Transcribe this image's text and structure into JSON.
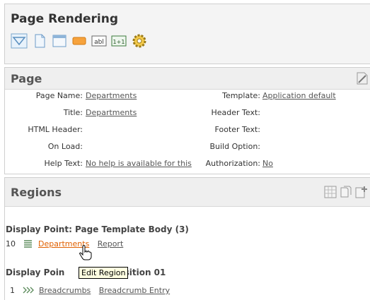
{
  "rendering": {
    "title": "Page Rendering",
    "toolbar_icons": [
      "triangle-filter-icon",
      "page-icon",
      "region-icon",
      "button-icon",
      "text-item-icon",
      "computation-icon",
      "process-icon"
    ],
    "text_item_glyph": "abl",
    "computation_glyph": "1+1"
  },
  "page": {
    "title": "Page",
    "fields": {
      "page_name_label": "Page Name:",
      "page_name_value": "Departments",
      "title_label": "Title:",
      "title_value": "Departments",
      "html_header_label": "HTML Header:",
      "on_load_label": "On Load:",
      "help_text_label": "Help Text:",
      "help_text_value": "No help is available for this",
      "template_label": "Template:",
      "template_value": "Application default",
      "header_text_label": "Header Text:",
      "footer_text_label": "Footer Text:",
      "build_option_label": "Build Option:",
      "authorization_label": "Authorization:",
      "authorization_value": "No"
    }
  },
  "regions": {
    "title": "Regions",
    "group1": {
      "heading": "Display Point: Page Template Body (3)",
      "row": {
        "seq": "10",
        "name": "Departments",
        "type": "Report"
      }
    },
    "group2": {
      "heading_part1": "Display Poin",
      "heading_part2": "osition 01",
      "row": {
        "seq": "1",
        "name": "Breadcrumbs",
        "type": "Breadcrumb Entry"
      }
    },
    "tooltip": "Edit Region"
  },
  "colors": {
    "link_active": "#e06000",
    "header_bg": "#efefef"
  }
}
